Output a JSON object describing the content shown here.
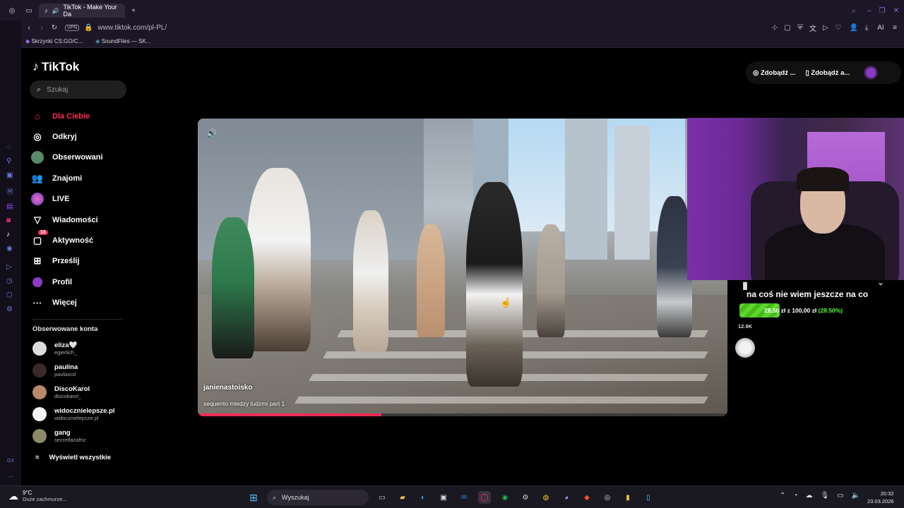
{
  "browser": {
    "tab_title": "TikTok - Make Your Da",
    "url": "www.tiktok.com/pl-PL/",
    "vpn_label": "VPN",
    "bookmarks": [
      "Skrzynki CS:GO/C...",
      "SoundFiles — SK..."
    ]
  },
  "tiktok": {
    "logo": "TikTok",
    "search_placeholder": "Szukaj",
    "nav": [
      {
        "label": "Dla Ciebie",
        "icon": "home-icon"
      },
      {
        "label": "Odkryj",
        "icon": "compass-icon"
      },
      {
        "label": "Obserwowani",
        "icon": "following-avatar-icon"
      },
      {
        "label": "Znajomi",
        "icon": "friends-icon"
      },
      {
        "label": "LIVE",
        "icon": "live-icon"
      },
      {
        "label": "Wiadomości",
        "icon": "inbox-icon"
      },
      {
        "label": "Aktywność",
        "icon": "activity-icon",
        "badge": "18"
      },
      {
        "label": "Prześlij",
        "icon": "upload-icon"
      },
      {
        "label": "Profil",
        "icon": "profile-icon"
      },
      {
        "label": "Więcej",
        "icon": "more-icon"
      }
    ],
    "following_title": "Obserwowane konta",
    "following": [
      {
        "name": "eliza🤍",
        "handle": "egierlich_"
      },
      {
        "name": "paulina",
        "handle": "paulaxcd"
      },
      {
        "name": "DiscoKarol",
        "handle": "discokarol_"
      },
      {
        "name": "widocznielepsze.pl",
        "handle": "widocznielepsze.pl"
      },
      {
        "name": "gang",
        "handle": "secretfazafriz"
      }
    ],
    "show_all": "Wyświetl wszystkie",
    "header_buttons": [
      "Zdobądź ...",
      "Zdobądź a..."
    ],
    "video": {
      "username": "janienastoisko",
      "description": "sequento miedzy ludzmi part 1",
      "progress": 0.347
    },
    "share_count": "12.9K"
  },
  "donation": {
    "title": "na coś nie wiem jeszcze na co",
    "amount": "28,50 zł",
    "of": "z",
    "goal": "100,00 zł",
    "percent": "(28.50%)"
  },
  "taskbar": {
    "temperature": "9°C",
    "weather": "Duże zachmurze...",
    "search": "Wyszukaj",
    "time": "20:32",
    "date": "23.03.2026"
  }
}
